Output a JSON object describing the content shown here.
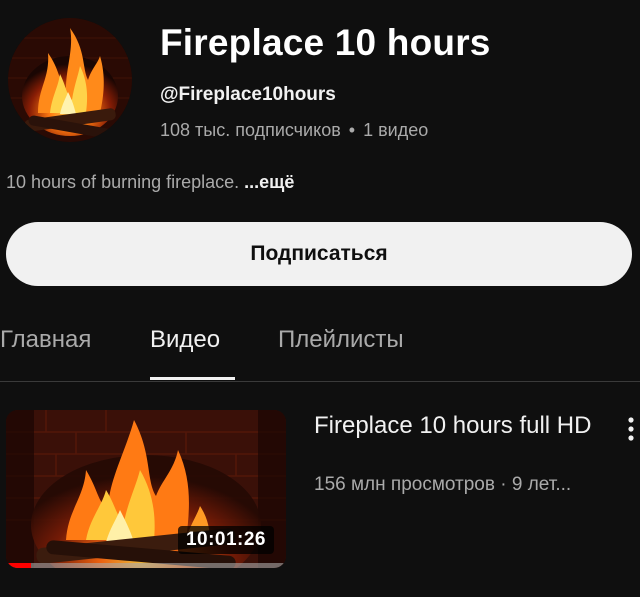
{
  "channel": {
    "name": "Fireplace 10 hours",
    "handle": "@Fireplace10hours",
    "subscribers": "108 тыс. подписчиков",
    "separator": "•",
    "video_count": "1 видео",
    "description": "10 hours of burning fireplace.",
    "more_label": "...ещё",
    "avatar_icon": "fireplace-avatar"
  },
  "subscribe": {
    "label": "Подписаться"
  },
  "tabs": [
    {
      "label": "Главная",
      "active": false
    },
    {
      "label": "Видео",
      "active": true
    },
    {
      "label": "Плейлисты",
      "active": false
    }
  ],
  "videos": [
    {
      "title": "Fireplace 10 hours full HD",
      "meta": "156 млн просмотров · 9 лет...",
      "duration": "10:01:26",
      "watch_progress": 0.09,
      "thumbnail_icon": "fireplace-thumbnail",
      "menu_icon": "more-vert-icon"
    }
  ],
  "colors": {
    "background": "#0f0f0f",
    "text_primary": "#f1f1f1",
    "text_secondary": "#aaaaaa",
    "button_bg": "#f1f1f1",
    "progress": "#ff0000"
  }
}
